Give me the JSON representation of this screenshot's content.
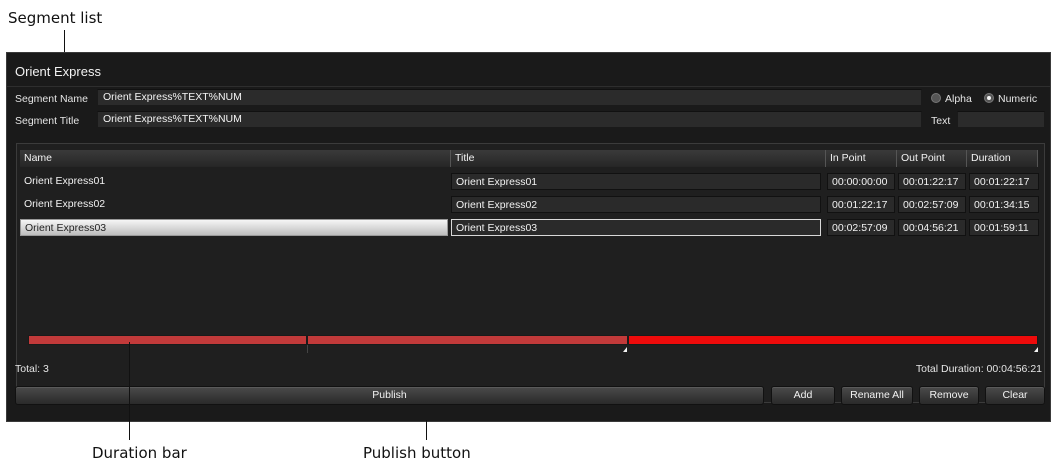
{
  "callouts": {
    "segment_list": "Segment list",
    "duration_bar": "Duration bar",
    "publish_button": "Publish button"
  },
  "window": {
    "title": "Orient Express"
  },
  "segment_name": {
    "label": "Segment Name",
    "value": "Orient Express%TEXT%NUM"
  },
  "segment_title": {
    "label": "Segment Title",
    "value": "Orient Express%TEXT%NUM"
  },
  "numbering": {
    "options": [
      {
        "label": "Alpha",
        "selected": false
      },
      {
        "label": "Numeric",
        "selected": true
      }
    ]
  },
  "text_field": {
    "label": "Text",
    "value": ""
  },
  "table": {
    "columns": [
      "Name",
      "Title",
      "In Point",
      "Out Point",
      "Duration"
    ],
    "rows": [
      {
        "name": "Orient Express01",
        "title": "Orient Express01",
        "in": "00:00:00:00",
        "out": "00:01:22:17",
        "duration": "00:01:22:17",
        "selected": false
      },
      {
        "name": "Orient Express02",
        "title": "Orient Express02",
        "in": "00:01:22:17",
        "out": "00:02:57:09",
        "duration": "00:01:34:15",
        "selected": false
      },
      {
        "name": "Orient Express03",
        "title": "Orient Express03",
        "in": "00:02:57:09",
        "out": "00:04:56:21",
        "duration": "00:01:59:11",
        "selected": true
      }
    ]
  },
  "duration_bar": {
    "segments_fraction": [
      0.276,
      0.318,
      0.406
    ],
    "colors": [
      "#c23a3a",
      "#c23a3a",
      "#ee0b0b"
    ]
  },
  "status": {
    "total": "Total: 3",
    "total_duration": "Total Duration: 00:04:56:21"
  },
  "buttons": {
    "publish": "Publish",
    "add": "Add",
    "rename_all": "Rename All",
    "remove": "Remove",
    "clear": "Clear"
  }
}
